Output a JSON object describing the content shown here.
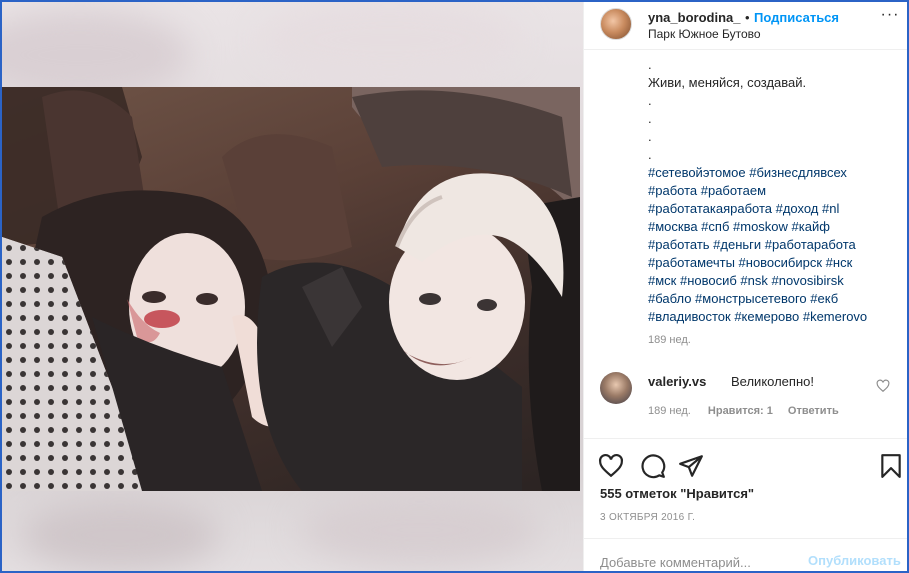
{
  "post": {
    "username": "yna_borodina_",
    "separator": "•",
    "follow_label": "Подписаться",
    "location": "Парк Южное Бутово",
    "more_glyph": "···"
  },
  "caption": {
    "lines": [
      ".",
      "Живи, меняйся, создавай.",
      ".",
      ".",
      ".",
      "."
    ],
    "hashtag_lines": [
      "#сетевойэтомое #бизнесдлявсех",
      "#работа #работаем",
      "#работатакаяработа #доход #nl",
      "#москва #спб #moskow #кайф",
      "#работать #деньги #работаработа",
      "#работамечты #новосибирск #нск",
      "#мск #новосиб #nsk #novosibirsk",
      "#бабло #монстрысетевого #екб",
      "#владивосток #кемерово #kemerovo"
    ],
    "time": "189 нед."
  },
  "comment": {
    "username": "valeriy.vs",
    "text": "Великолепно!",
    "time": "189 нед.",
    "likes": "Нравится: 1",
    "reply": "Ответить"
  },
  "actions": {
    "likes_count": "555 отметок \"Нравится\"",
    "date": "3 ОКТЯБРЯ 2016 Г."
  },
  "add_comment": {
    "placeholder": "Добавьте комментарий...",
    "publish_label": "Опубликовать"
  },
  "colors": {
    "link": "#0095f6",
    "hashtag": "#00376b",
    "meta": "#8e8e8e",
    "frame": "#2b63c6"
  }
}
